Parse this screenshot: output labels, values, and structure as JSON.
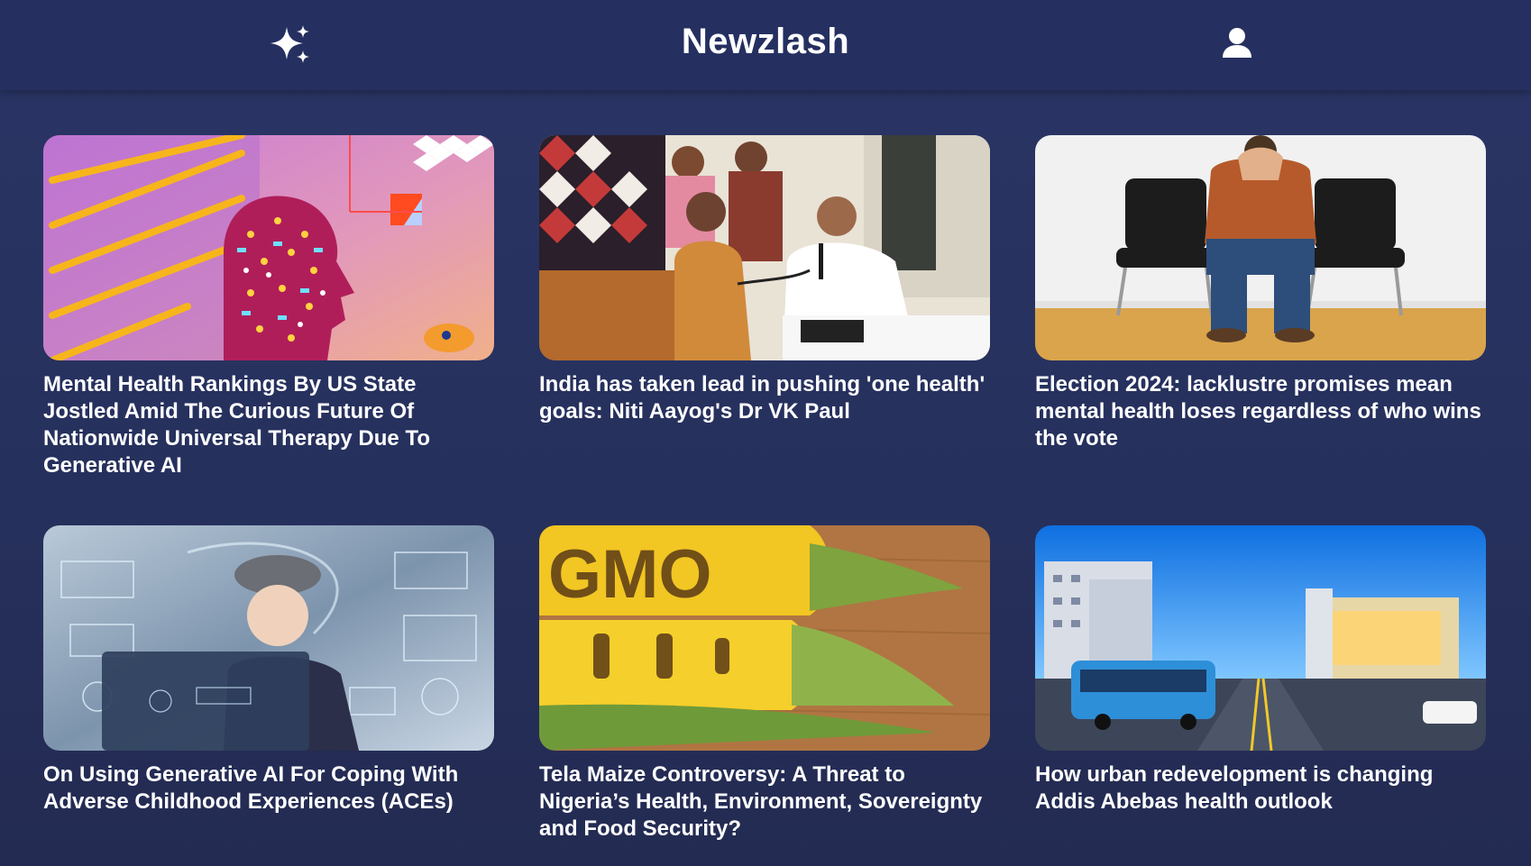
{
  "header": {
    "brand": "Newzlash",
    "sparkle_icon": "sparkle-icon",
    "user_icon": "user-icon"
  },
  "articles": [
    {
      "title": "Mental Health Rankings By US State Jostled Amid The Curious Future Of Nationwide Universal Therapy Due To Generative AI"
    },
    {
      "title": "India has taken lead in pushing 'one health' goals: Niti Aayog's Dr VK Paul"
    },
    {
      "title": "Election 2024: lacklustre promises mean mental health loses regardless of who wins the vote"
    },
    {
      "title": "On Using Generative AI For Coping With Adverse Childhood Experiences (ACEs)"
    },
    {
      "title": "Tela Maize Controversy: A Threat to Nigeria’s Health, Environment, Sovereignty and Food Security?"
    },
    {
      "title": "How urban redevelopment is changing Addis Abebas health outlook"
    }
  ],
  "image_lettering": {
    "corn_word": "GMO"
  },
  "colors": {
    "background": "#26305c",
    "header": "#253060",
    "text": "#ffffff"
  }
}
